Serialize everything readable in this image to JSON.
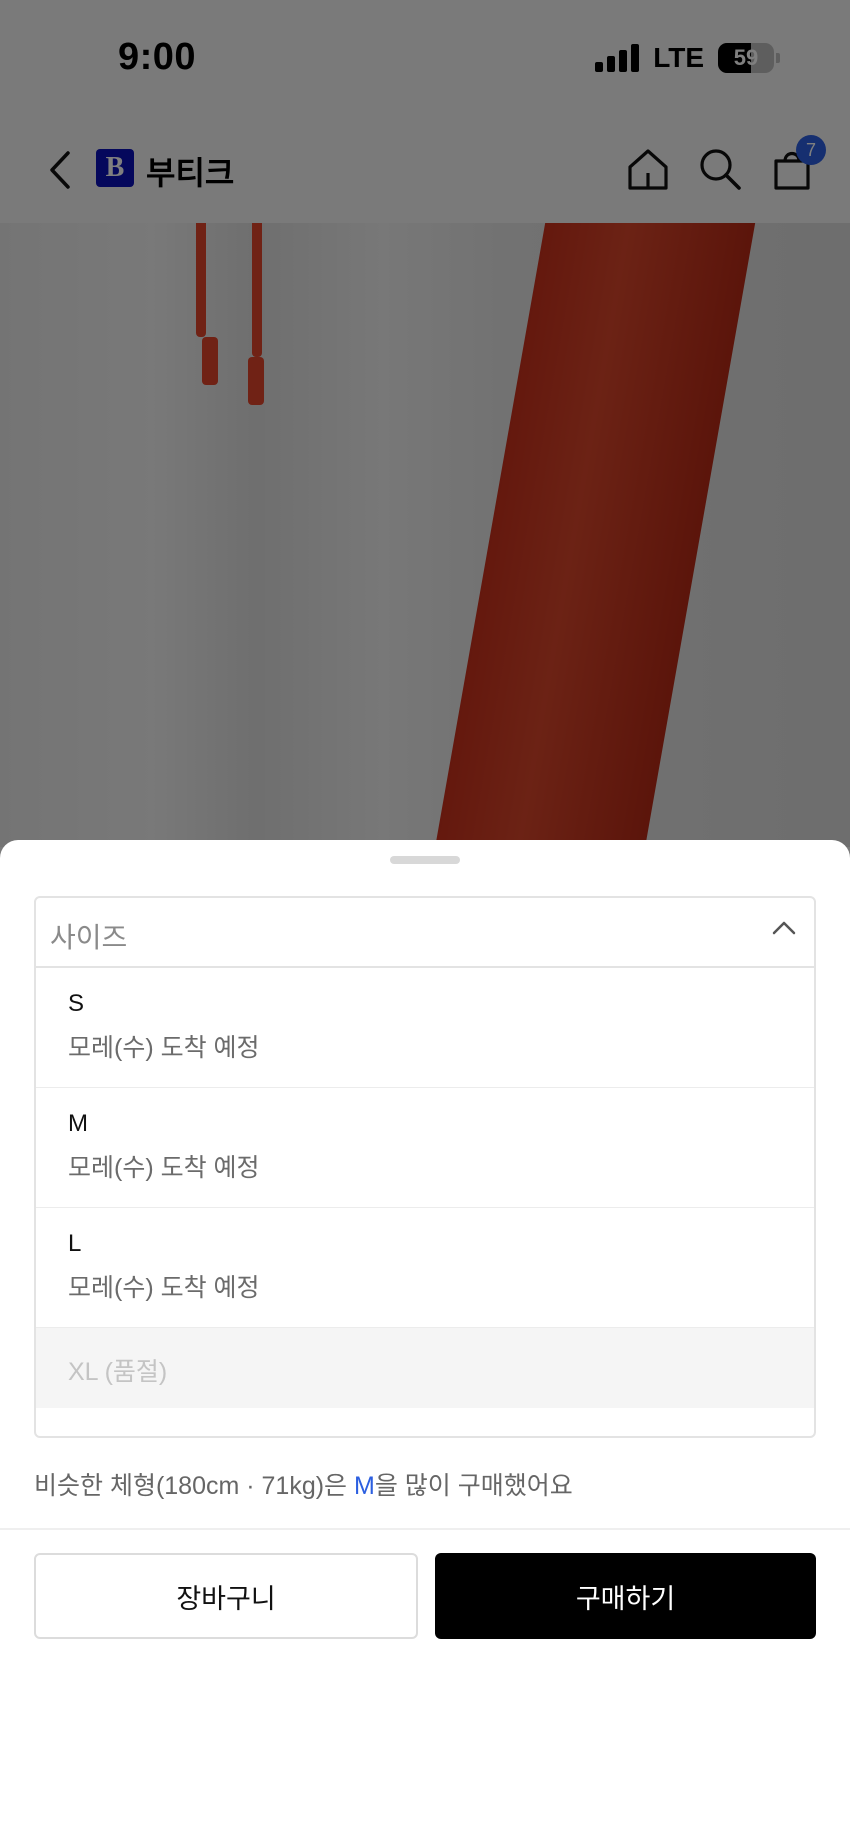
{
  "status_bar": {
    "time": "9:00",
    "network": "LTE",
    "battery_level": "59",
    "battery_percent": 59
  },
  "header": {
    "brand_logo_letter": "B",
    "brand_name": "부티크",
    "cart_count": "7",
    "icons": [
      "back-icon",
      "home-icon",
      "search-icon",
      "cart-icon"
    ]
  },
  "product_image": {
    "accent_color": "#e0452a"
  },
  "size_selector": {
    "label": "사이즈",
    "options": [
      {
        "size": "S",
        "status": "모레(수) 도착 예정",
        "available": true
      },
      {
        "size": "M",
        "status": "모레(수) 도착 예정",
        "available": true
      },
      {
        "size": "L",
        "status": "모레(수) 도착 예정",
        "available": true
      },
      {
        "size": "XL (품절)",
        "status": "",
        "available": false
      }
    ]
  },
  "recommendation": {
    "prefix": "비슷한 체형(180cm · 71kg)은 ",
    "highlight": "M",
    "suffix": "을 많이 구매했어요"
  },
  "actions": {
    "cart_label": "장바구니",
    "buy_label": "구매하기"
  },
  "colors": {
    "accent_blue": "#2c5fe0",
    "brand_navy": "#0a10b8",
    "buy_button": "#000000"
  }
}
